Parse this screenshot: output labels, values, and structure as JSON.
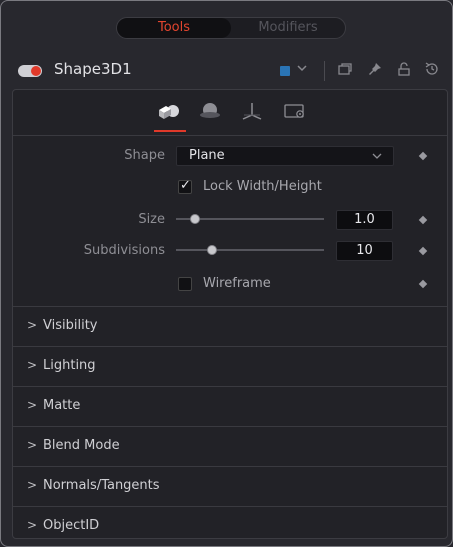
{
  "tabs": [
    {
      "label": "Tools",
      "active": true
    },
    {
      "label": "Modifiers",
      "active": false
    }
  ],
  "header": {
    "tool_name": "Shape3D1",
    "enabled": true,
    "color_chip": "#2a74b5",
    "icons": [
      "color-dropdown-icon",
      "version-icon",
      "pin-icon",
      "lock-icon",
      "reset-icon"
    ]
  },
  "mode_tabs": [
    "controls-icon",
    "material-icon",
    "transform-icon",
    "settings-icon"
  ],
  "controls": {
    "shape_label": "Shape",
    "shape_value": "Plane",
    "lock_label": "Lock Width/Height",
    "lock_checked": true,
    "size_label": "Size",
    "size_value": "1.0",
    "subdivisions_label": "Subdivisions",
    "subdivisions_value": "10",
    "wireframe_label": "Wireframe",
    "wireframe_checked": false
  },
  "sections": [
    "Visibility",
    "Lighting",
    "Matte",
    "Blend Mode",
    "Normals/Tangents",
    "ObjectID"
  ],
  "colors": {
    "accent": "#e0392a",
    "background": "#28282e",
    "panel": "#222227"
  }
}
